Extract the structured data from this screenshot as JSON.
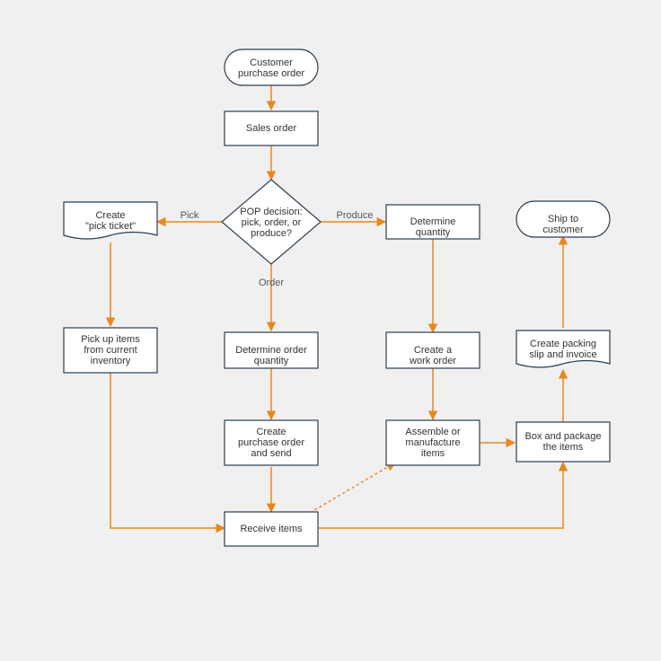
{
  "nodes": {
    "customer_po": "Customer\npurchase order",
    "sales_order": "Sales order",
    "pop_decision": "POP decision:\npick, order, or\nproduce?",
    "create_pick_ticket": "Create\n\"pick ticket\"",
    "determine_qty": "Determine\nquantity",
    "ship": "Ship to\ncustomer",
    "pickup_items": "Pick up items\nfrom current\ninventory",
    "determine_order_qty": "Determine order\nquantity",
    "create_work_order": "Create a\nwork order",
    "create_packing": "Create packing\nslip and invoice",
    "create_po_send": "Create\npurchase order\nand send",
    "assemble": "Assemble or\nmanufacture\nitems",
    "box_package": "Box and package\nthe items",
    "receive_items": "Receive items"
  },
  "edge_labels": {
    "pick": "Pick",
    "order": "Order",
    "produce": "Produce"
  },
  "colors": {
    "arrow": "#e8871e",
    "node_border": "#2c3e50",
    "bg": "#f0f0f0"
  }
}
